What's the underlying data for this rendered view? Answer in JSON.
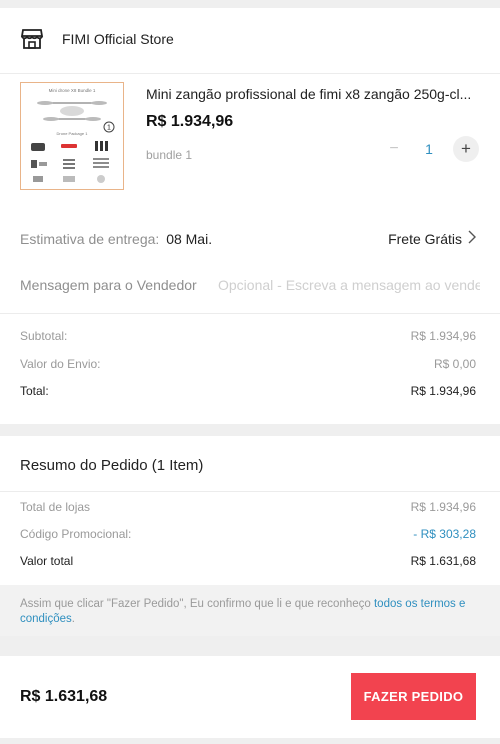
{
  "store": {
    "name": "FIMI Official Store",
    "icon": "store-icon"
  },
  "product": {
    "title": "Mini zangão profissional de fimi x8 zangão 250g-cl...",
    "price": "R$ 1.934,96",
    "variant": "bundle 1",
    "quantity": "1",
    "decrement": "−",
    "increment": "+",
    "thumb_title": "Mini drone X8 Bundle 1",
    "thumb_badge": "1",
    "thumb_package": "Drone Package 1"
  },
  "delivery": {
    "label": "Estimativa de entrega:",
    "date": "08 Mai.",
    "shipping": "Frete Grátis"
  },
  "message": {
    "label": "Mensagem para o Vendedor",
    "placeholder": "Opcional - Escreva a mensagem ao vendedor"
  },
  "totals": {
    "subtotal_label": "Subtotal:",
    "subtotal_value": "R$ 1.934,96",
    "shipping_label": "Valor do Envio:",
    "shipping_value": "R$ 0,00",
    "total_label": "Total:",
    "total_value": "R$ 1.934,96"
  },
  "summary": {
    "title": "Resumo do Pedido (1 Item)",
    "stores_label": "Total de lojas",
    "stores_value": "R$ 1.934,96",
    "promo_label": "Código Promocional:",
    "promo_value": "- R$ 303,28",
    "final_label": "Valor total",
    "final_value": "R$ 1.631,68"
  },
  "terms": {
    "text": "Assim que clicar \"Fazer Pedido\", Eu confirmo que li e que reconheço ",
    "link": "todos os termos e condições",
    "end": "."
  },
  "footer": {
    "total": "R$ 1.631,68",
    "button": "FAZER PEDIDO"
  },
  "colors": {
    "accent": "#f2434f",
    "link": "#2f8fbf",
    "promo": "#2f8fbf"
  }
}
